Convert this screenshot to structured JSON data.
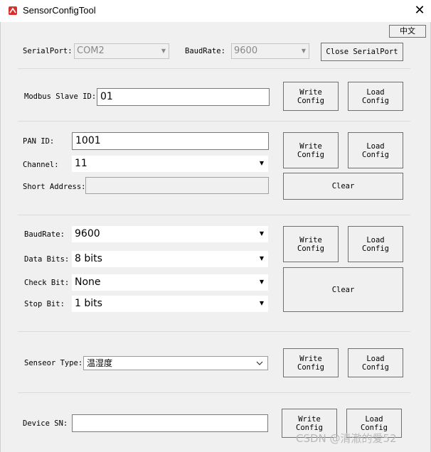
{
  "window": {
    "title": "SensorConfigTool",
    "close_glyph": "✕",
    "icon": "app-sensor-icon"
  },
  "language_button": "中文",
  "serial": {
    "port_label": "SerialPort:",
    "port_value": "COM2",
    "baud_label": "BaudRate:",
    "baud_value": "9600",
    "close_button": "Close SerialPort"
  },
  "modbus": {
    "slave_id_label": "Modbus Slave ID:",
    "slave_id_value": "01",
    "write_button": "Write\nConfig",
    "load_button": "Load\nConfig"
  },
  "zigbee": {
    "pan_id_label": "PAN ID:",
    "pan_id_value": "1001",
    "channel_label": "Channel:",
    "channel_value": "11",
    "short_addr_label": "Short Address:",
    "short_addr_value": "",
    "write_button": "Write\nConfig",
    "load_button": "Load\nConfig",
    "clear_button": "Clear"
  },
  "uart": {
    "baud_label": "BaudRate:",
    "baud_value": "9600",
    "data_bits_label": "Data Bits:",
    "data_bits_value": "8 bits",
    "check_bit_label": "Check Bit:",
    "check_bit_value": "None",
    "stop_bit_label": "Stop Bit:",
    "stop_bit_value": "1 bits",
    "write_button": "Write\nConfig",
    "load_button": "Load\nConfig",
    "clear_button": "Clear"
  },
  "sensor": {
    "type_label": "Senseor Type:",
    "type_value": "温湿度",
    "write_button": "Write\nConfig",
    "load_button": "Load\nConfig"
  },
  "device": {
    "sn_label": "Device SN:",
    "sn_value": "",
    "write_button": "Write\nConfig",
    "load_button": "Load\nConfig"
  },
  "watermark": "CSDN @清澈的爱52",
  "colors": {
    "window_bg": "#f0f0f0",
    "titlebar_bg": "#ffffff",
    "border": "#6f6f6f",
    "icon_red": "#d9302c"
  }
}
